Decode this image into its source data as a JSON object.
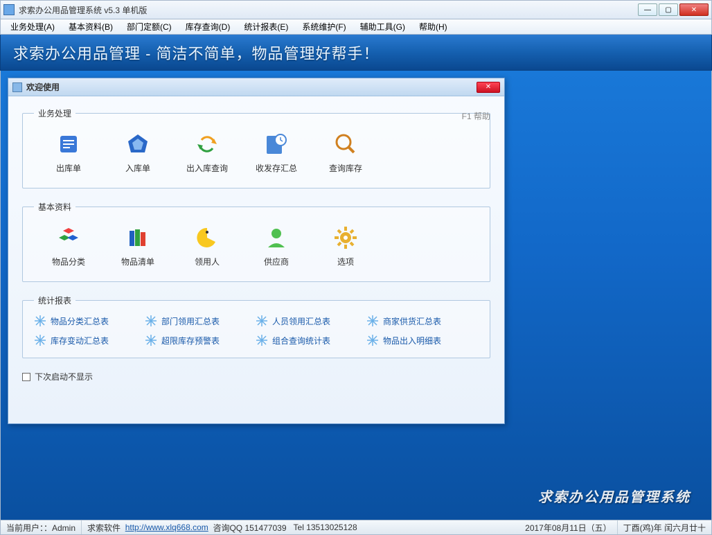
{
  "window": {
    "title": "求索办公用品管理系统 v5.3 单机版"
  },
  "menu": [
    "业务处理(A)",
    "基本资料(B)",
    "部门定额(C)",
    "库存查询(D)",
    "统计报表(E)",
    "系统维护(F)",
    "辅助工具(G)",
    "帮助(H)"
  ],
  "banner": "求索办公用品管理 - 简洁不简单，物品管理好帮手！",
  "dialog": {
    "title": "欢迎使用",
    "help_hint": "F1 帮助",
    "groups": {
      "business": {
        "legend": "业务处理",
        "items": [
          "出库单",
          "入库单",
          "出入库查询",
          "收发存汇总",
          "查询库存"
        ]
      },
      "basic": {
        "legend": "基本资料",
        "items": [
          "物品分类",
          "物品清单",
          "领用人",
          "供应商",
          "选项"
        ]
      },
      "reports": {
        "legend": "统计报表",
        "items": [
          "物品分类汇总表",
          "部门领用汇总表",
          "人员领用汇总表",
          "商家供货汇总表",
          "库存变动汇总表",
          "超限库存预警表",
          "组合查询统计表",
          "物品出入明细表"
        ]
      }
    },
    "startup_checkbox": "下次启动不显示"
  },
  "brand": "求索办公用品管理系统",
  "status": {
    "user_label": "当前用户：：Admin",
    "company": "求索软件",
    "url": "http://www.xlq668.com",
    "qq": "咨询QQ 151477039",
    "tel": "Tel 13513025128",
    "date": "2017年08月11日（五）",
    "lunar": "丁酉(鸡)年 闰六月廿十"
  }
}
